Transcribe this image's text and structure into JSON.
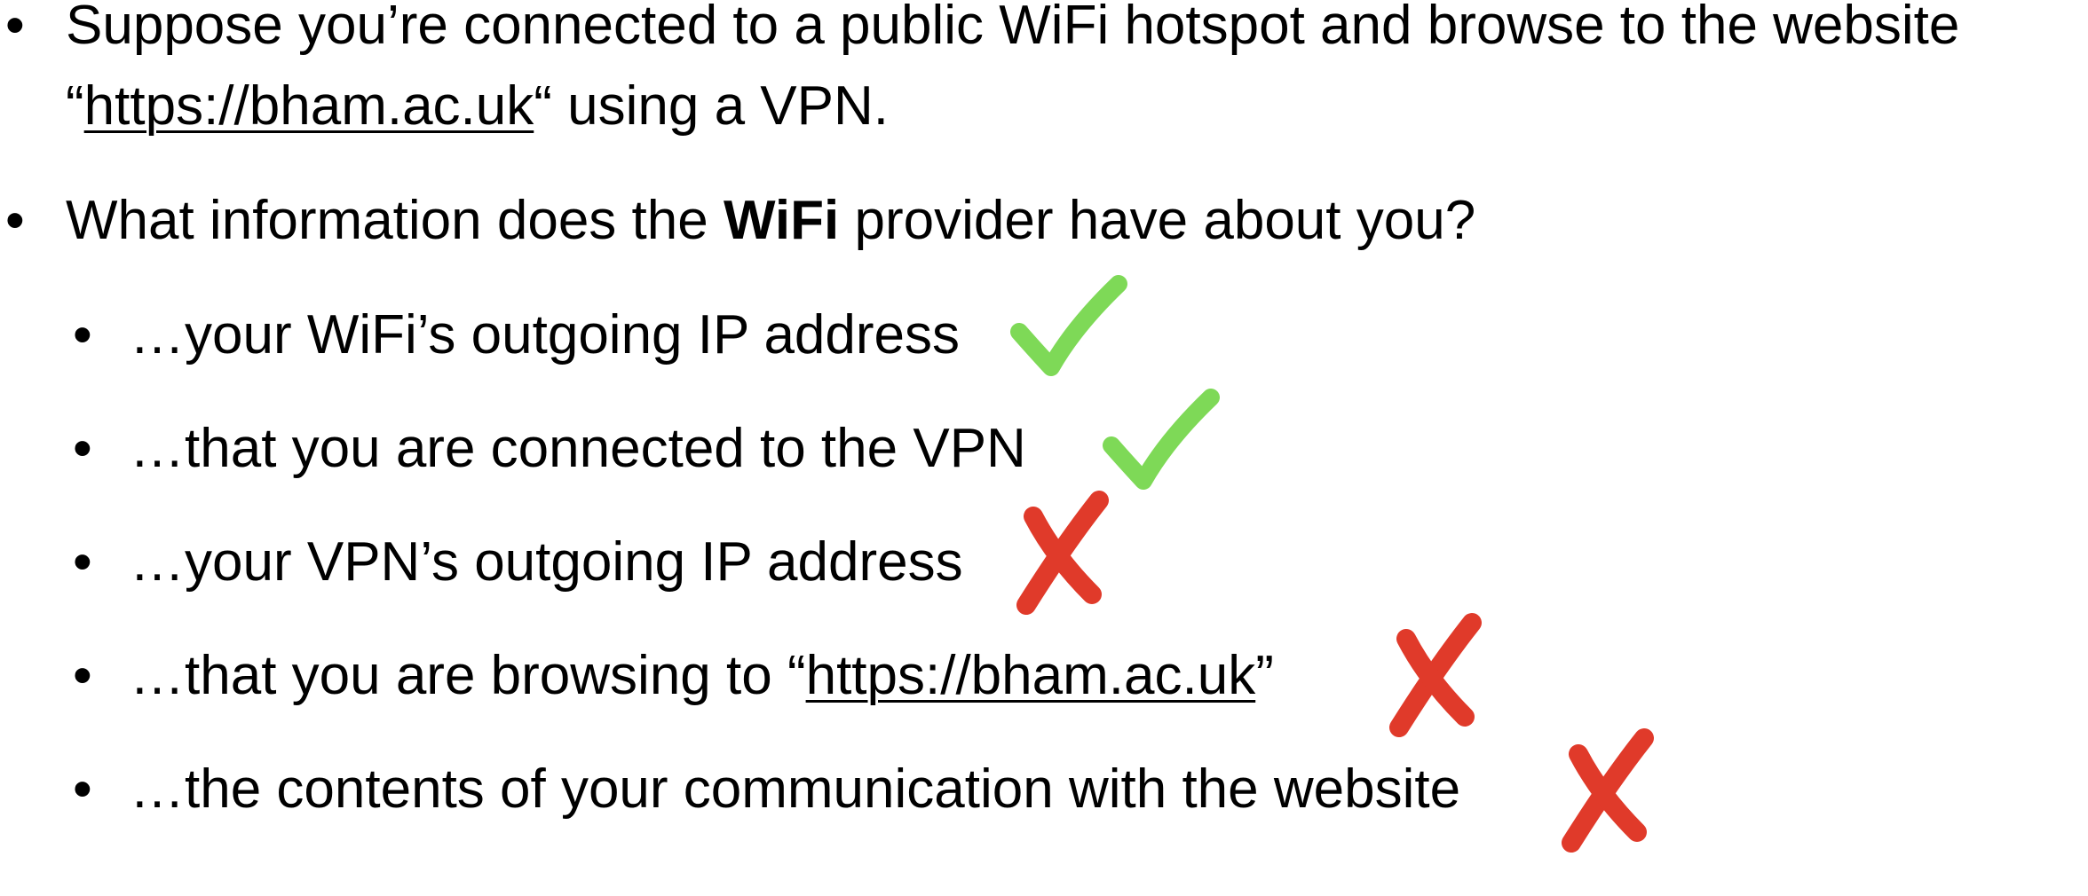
{
  "slide": {
    "bullets": [
      {
        "line1": "Suppose you’re connected to a public WiFi hotspot and browse to the website",
        "line2_open_quote": "“",
        "link": "https://bham.ac.uk",
        "line2_rest": "“ using a VPN."
      },
      {
        "text_before": "What information does the ",
        "text_bold": "WiFi",
        "text_after": " provider have about you?"
      }
    ],
    "sub_bullets": [
      {
        "text": "…your WiFi’s outgoing IP address",
        "answer": "yes",
        "mark_icon": "check-icon"
      },
      {
        "text": "…that you are connected to the VPN",
        "answer": "yes",
        "mark_icon": "check-icon"
      },
      {
        "text": "…your VPN’s outgoing IP address",
        "answer": "no",
        "mark_icon": "cross-icon"
      },
      {
        "text_before": "…that you are browsing to “",
        "link": "https://bham.ac.uk",
        "text_after": "”",
        "answer": "no",
        "mark_icon": "cross-icon"
      },
      {
        "text": "…the contents of your communication with the website",
        "answer": "no",
        "mark_icon": "cross-icon"
      }
    ],
    "colors": {
      "check": "#7ED957",
      "cross": "#E03A2A",
      "text": "#000000"
    }
  }
}
